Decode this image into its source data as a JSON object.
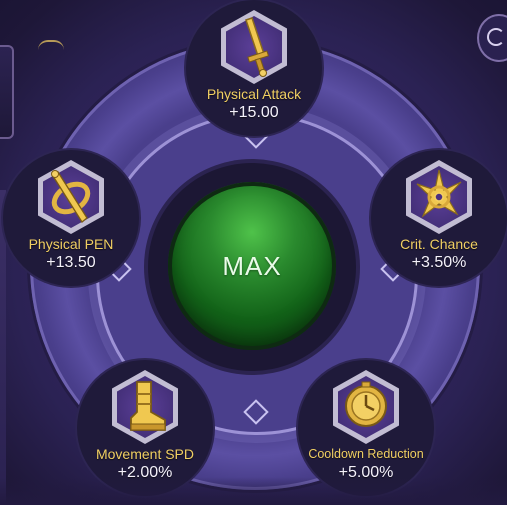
{
  "center": {
    "label": "MAX"
  },
  "stats": [
    {
      "name": "Physical Attack",
      "value": "+15.00",
      "icon": "sword-icon"
    },
    {
      "name": "Crit. Chance",
      "value": "+3.50%",
      "icon": "crit-star-icon"
    },
    {
      "name": "Cooldown Reduction",
      "value": "+5.00%",
      "icon": "clock-shield-icon"
    },
    {
      "name": "Movement SPD",
      "value": "+2.00%",
      "icon": "boot-icon"
    },
    {
      "name": "Physical PEN",
      "value": "+13.50",
      "icon": "pierce-sword-icon"
    }
  ],
  "colors": {
    "label_gold": "#f0cf63",
    "value_white": "#f4f1fb",
    "core_green": "#2a8a2e",
    "wheel_purple": "#4a3f8c"
  }
}
